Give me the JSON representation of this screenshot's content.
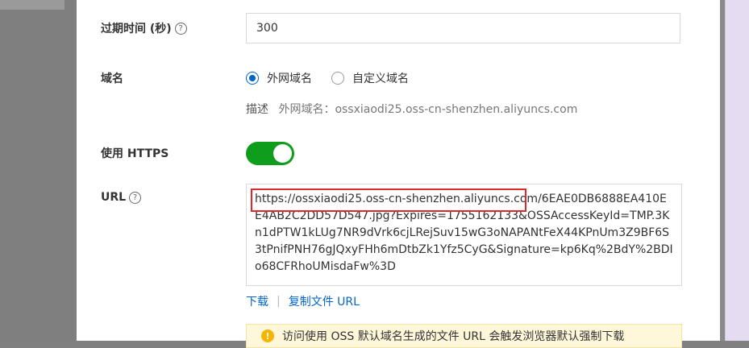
{
  "form": {
    "expire": {
      "label": "过期时间 (秒)",
      "help": "?",
      "value": "300"
    },
    "domain": {
      "label": "域名",
      "options": [
        "外网域名",
        "自定义域名"
      ],
      "selected": "外网域名",
      "desc_key": "描述",
      "desc_value": "外网域名：ossxiaodi25.oss-cn-shenzhen.aliyuncs.com"
    },
    "https": {
      "label": "使用 HTTPS",
      "enabled": true
    },
    "url": {
      "label": "URL",
      "help": "?",
      "value": "https://ossxiaodi25.oss-cn-shenzhen.aliyuncs.com/6EAE0DB6888EA410EE4AB2C2DD57D547.jpg?Expires=1755162133&OSSAccessKeyId=TMP.3Kn1dPTW1kLUg7NR9dVrk6cjLRejSuv15wG3oNAPANtFeX44KPnUm3Z9BF6S3tPnifPNH76gJQxyFHh6mDtbZk1Yfz5CyG&Signature=kp6Kq%2BdY%2BDIo68CFRhoUMisdaFw%3D"
    },
    "actions": {
      "download": "下载",
      "separator": "|",
      "copy": "复制文件 URL"
    },
    "warning": {
      "icon": "!",
      "text": "访问使用 OSS 默认域名生成的文件 URL 会触发浏览器默认强制下载"
    }
  },
  "colors": {
    "accent": "#0064c8",
    "toggle_on": "#0f9d1c",
    "highlight": "#e0272a"
  }
}
